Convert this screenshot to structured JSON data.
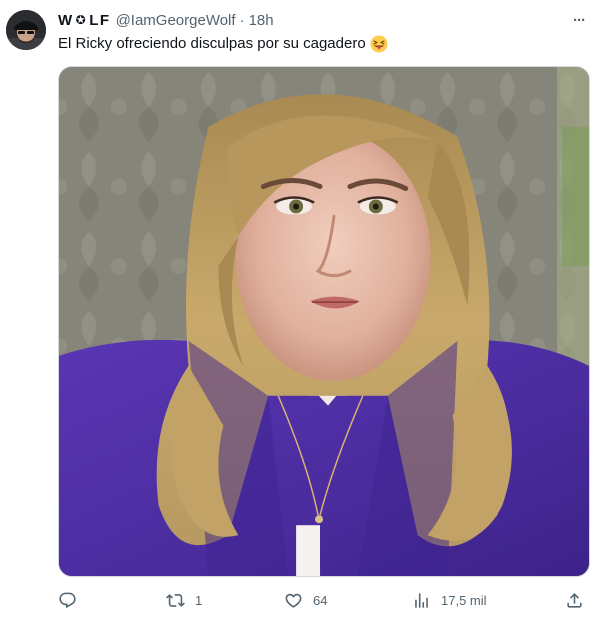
{
  "tweet": {
    "display_name": "W",
    "display_name_mid": "LF",
    "gear_symbol": "✪",
    "handle": "@IamGeorgeWolf",
    "separator": "·",
    "time": "18h",
    "more_symbol": "···",
    "text": "El Ricky ofreciendo disculpas por su cagadero",
    "emoji": "squinting-face-with-tongue"
  },
  "actions": {
    "reply": {
      "icon": "reply-icon",
      "count": ""
    },
    "retweet": {
      "icon": "retweet-icon",
      "count": "1"
    },
    "like": {
      "icon": "heart-icon",
      "count": "64"
    },
    "views": {
      "icon": "views-icon",
      "count": "17,5 mil"
    },
    "share": {
      "icon": "share-icon",
      "count": ""
    }
  },
  "colors": {
    "text_primary": "#0f1419",
    "text_secondary": "#536471",
    "border": "#cfd9de",
    "jacket": "#4b2f9e",
    "wallpaper": "#8a8a7c"
  }
}
